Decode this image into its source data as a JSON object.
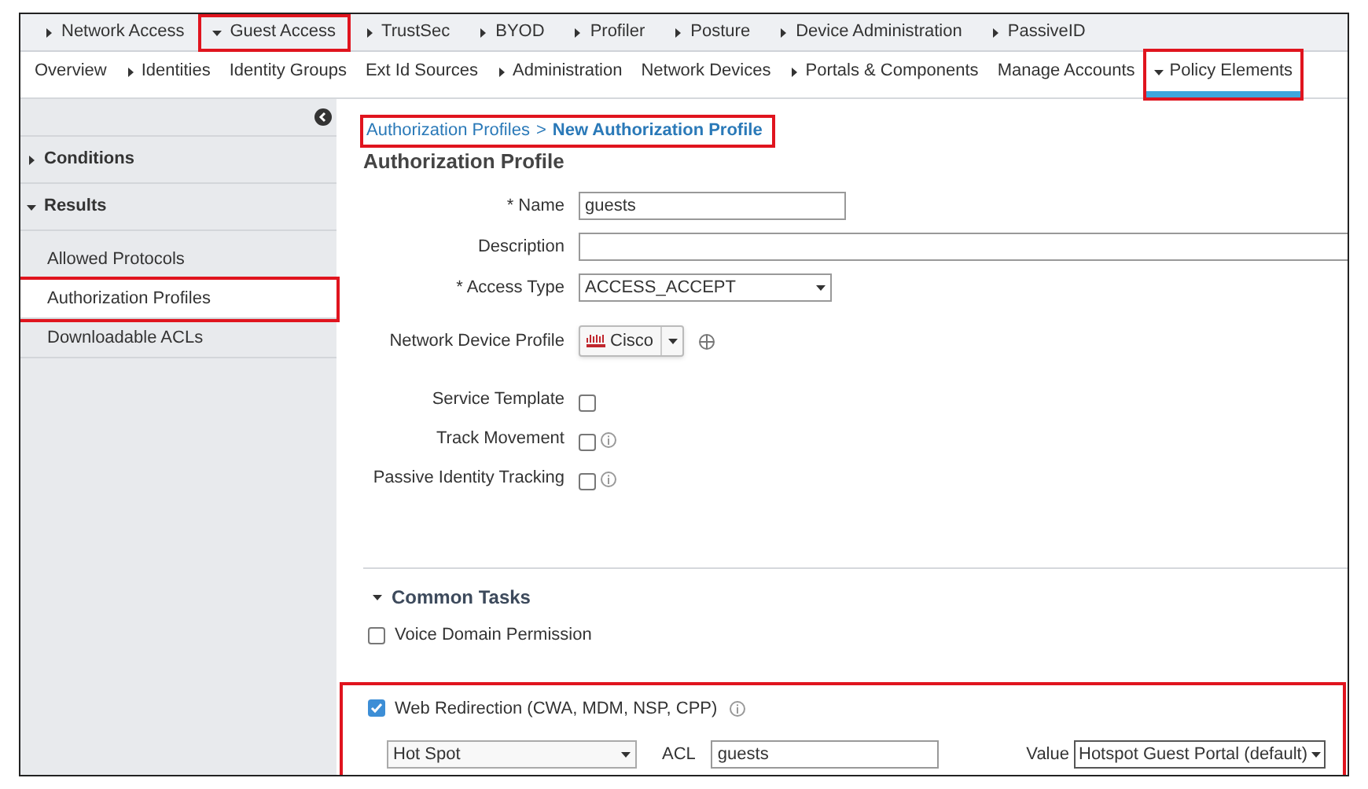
{
  "top_nav": [
    {
      "label": "Network Access",
      "expanded": false,
      "highlighted": false
    },
    {
      "label": "Guest Access",
      "expanded": true,
      "highlighted": true
    },
    {
      "label": "TrustSec",
      "expanded": false,
      "highlighted": false
    },
    {
      "label": "BYOD",
      "expanded": false,
      "highlighted": false
    },
    {
      "label": "Profiler",
      "expanded": false,
      "highlighted": false
    },
    {
      "label": "Posture",
      "expanded": false,
      "highlighted": false
    },
    {
      "label": "Device Administration",
      "expanded": false,
      "highlighted": false
    },
    {
      "label": "PassiveID",
      "expanded": false,
      "highlighted": false
    }
  ],
  "sub_nav": [
    {
      "label": "Overview",
      "kind": "link",
      "selected": false,
      "highlighted": false
    },
    {
      "label": "Identities",
      "kind": "menu",
      "selected": false,
      "highlighted": false
    },
    {
      "label": "Identity Groups",
      "kind": "link",
      "selected": false,
      "highlighted": false
    },
    {
      "label": "Ext Id Sources",
      "kind": "link",
      "selected": false,
      "highlighted": false
    },
    {
      "label": "Administration",
      "kind": "menu",
      "selected": false,
      "highlighted": false
    },
    {
      "label": "Network Devices",
      "kind": "link",
      "selected": false,
      "highlighted": false
    },
    {
      "label": "Portals & Components",
      "kind": "menu",
      "selected": false,
      "highlighted": false
    },
    {
      "label": "Manage Accounts",
      "kind": "link",
      "selected": false,
      "highlighted": false
    },
    {
      "label": "Policy Elements",
      "kind": "open_menu",
      "selected": true,
      "highlighted": true
    }
  ],
  "sidebar": {
    "sections": [
      {
        "label": "Conditions",
        "expanded": false
      },
      {
        "label": "Results",
        "expanded": true,
        "children": [
          {
            "label": "Allowed Protocols",
            "selected": false,
            "highlighted": false
          },
          {
            "label": "Authorization Profiles",
            "selected": true,
            "highlighted": true
          },
          {
            "label": "Downloadable ACLs",
            "selected": false,
            "highlighted": false
          }
        ]
      }
    ]
  },
  "breadcrumb": {
    "highlighted": true,
    "items": [
      {
        "label": "Authorization Profiles"
      },
      {
        "label": "New Authorization Profile"
      }
    ],
    "separator": ">"
  },
  "heading": "Authorization Profile",
  "form": {
    "rows": [
      {
        "kind": "text",
        "label": "* Name",
        "value": "guests"
      },
      {
        "kind": "wide",
        "label": "Description"
      },
      {
        "kind": "select",
        "label": "* Access Type",
        "value": "ACCESS_ACCEPT"
      },
      {
        "kind": "device",
        "label": "Network Device Profile",
        "value": "Cisco"
      },
      {
        "kind": "checkbox",
        "label": "Service Template",
        "checked": false,
        "info": false
      },
      {
        "kind": "checkbox",
        "label": "Track Movement",
        "checked": false,
        "info": true
      },
      {
        "kind": "checkbox",
        "label": "Passive Identity Tracking",
        "checked": false,
        "info": true
      }
    ]
  },
  "common_tasks": {
    "title": "Common Tasks",
    "expanded": true,
    "items": [
      {
        "kind": "checkbox",
        "label": "Voice Domain Permission",
        "checked": false,
        "highlighted": false
      },
      {
        "kind": "redirect",
        "label": "Web Redirection (CWA, MDM, NSP, CPP)",
        "checked": true,
        "highlighted": true,
        "type": "Hot Spot",
        "acl_label": "ACL",
        "acl": "guests",
        "value_label": "Value",
        "value": "Hotspot Guest Portal (default)"
      }
    ]
  }
}
